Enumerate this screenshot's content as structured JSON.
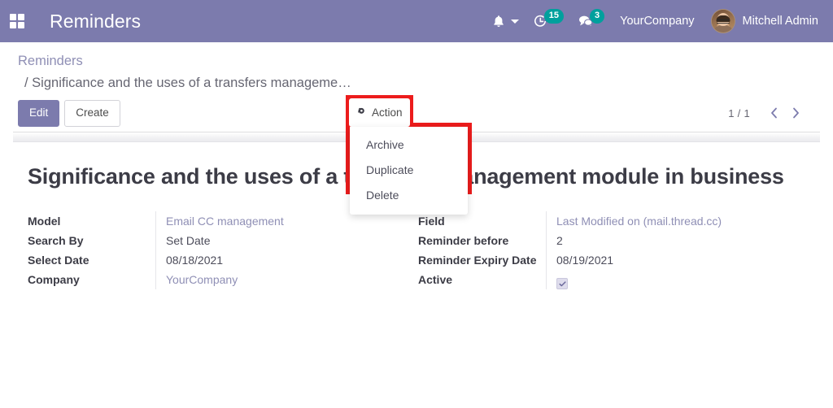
{
  "navbar": {
    "apps_icon": "apps-grid-icon",
    "brand_title": "Reminders",
    "bell_icon": "bell-icon",
    "activity_icon": "activity-clock-icon",
    "activity_count": "15",
    "messages_icon": "messages-icon",
    "messages_count": "3",
    "company": "YourCompany",
    "avatar": "user-avatar",
    "user_name": "Mitchell Admin",
    "accent_color": "#7c7bad",
    "badge_color": "#00a09d"
  },
  "control_panel": {
    "breadcrumb_root": "Reminders",
    "breadcrumb_current": "/ Significance and the uses of a transfers manageme…",
    "edit_label": "Edit",
    "create_label": "Create",
    "action_label": "Action",
    "gear_icon": "gear-icon",
    "pager_value": "1 / 1",
    "prev_icon": "chevron-left-icon",
    "next_icon": "chevron-right-icon",
    "highlight_color": "#ec1c1c"
  },
  "action_menu": {
    "items": [
      {
        "label": "Archive"
      },
      {
        "label": "Duplicate"
      },
      {
        "label": "Delete"
      }
    ]
  },
  "record": {
    "title": "Significance and the uses of a transfers management module in business",
    "left_fields": [
      {
        "label": "Model",
        "value": "Email CC management",
        "style": "link"
      },
      {
        "label": "Search By",
        "value": "Set Date",
        "style": "text"
      },
      {
        "label": "Select Date",
        "value": "08/18/2021",
        "style": "text"
      },
      {
        "label": "Company",
        "value": "YourCompany",
        "style": "link"
      }
    ],
    "right_fields": [
      {
        "label": "Field",
        "value": "Last Modified on (mail.thread.cc)",
        "style": "link"
      },
      {
        "label": "Reminder before",
        "value": "2",
        "style": "text"
      },
      {
        "label": "Reminder Expiry Date",
        "value": "08/19/2021",
        "style": "text"
      },
      {
        "label": "Active",
        "value": "",
        "style": "checkbox",
        "checked": true
      }
    ]
  }
}
